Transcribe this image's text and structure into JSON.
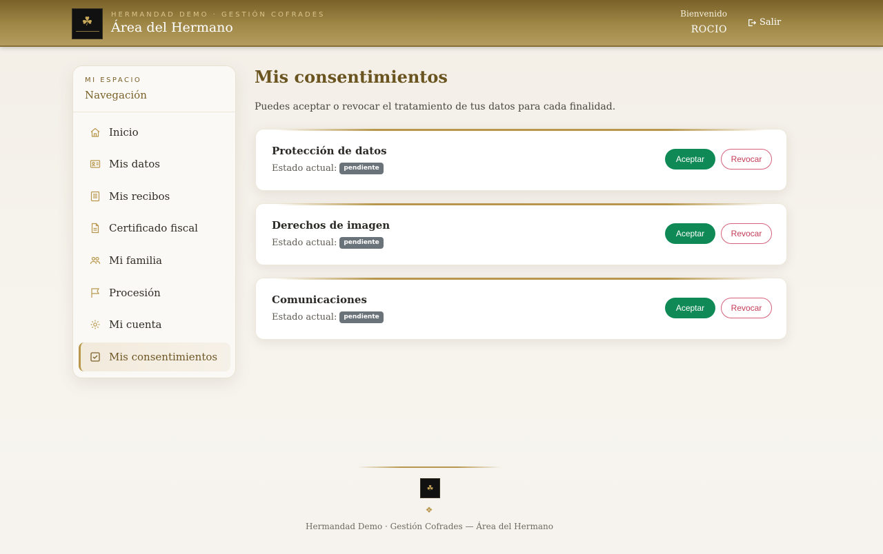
{
  "header": {
    "logo_icon": "brotherhood-crest-icon",
    "brand_sub": "HERMANDAD DEMO · GESTIÓN COFRADES",
    "title": "Área del Hermano",
    "welcome_label": "Bienvenido",
    "username": "ROCIO",
    "logout_label": "Salir",
    "logout_icon": "logout-icon"
  },
  "sidebar": {
    "kicker": "MI ESPACIO",
    "title": "Navegación",
    "items": [
      {
        "label": "Inicio",
        "icon": "home-icon"
      },
      {
        "label": "Mis datos",
        "icon": "id-card-icon"
      },
      {
        "label": "Mis recibos",
        "icon": "receipt-icon"
      },
      {
        "label": "Certificado fiscal",
        "icon": "document-icon"
      },
      {
        "label": "Mi familia",
        "icon": "family-icon"
      },
      {
        "label": "Procesión",
        "icon": "flag-icon"
      },
      {
        "label": "Mi cuenta",
        "icon": "gear-icon"
      },
      {
        "label": "Mis consentimientos",
        "icon": "checkbox-icon",
        "active": true
      }
    ]
  },
  "main": {
    "title": "Mis consentimientos",
    "description": "Puedes aceptar o revocar el tratamiento de tus datos para cada finalidad.",
    "state_label": "Estado actual:",
    "accept_label": "Aceptar",
    "revoke_label": "Revocar",
    "consents": [
      {
        "title": "Protección de datos",
        "status": "pendiente"
      },
      {
        "title": "Derechos de imagen",
        "status": "pendiente"
      },
      {
        "title": "Comunicaciones",
        "status": "pendiente"
      }
    ]
  },
  "footer": {
    "ornament": "❖",
    "text": "Hermandad Demo · Gestión Cofrades — Área del Hermano"
  },
  "colors": {
    "brand_gold": "#7a6128",
    "accent_gold": "#b8974c",
    "accept_green": "#0f8a56",
    "revoke_red": "#c43b56",
    "badge_gray": "#6b737a"
  }
}
